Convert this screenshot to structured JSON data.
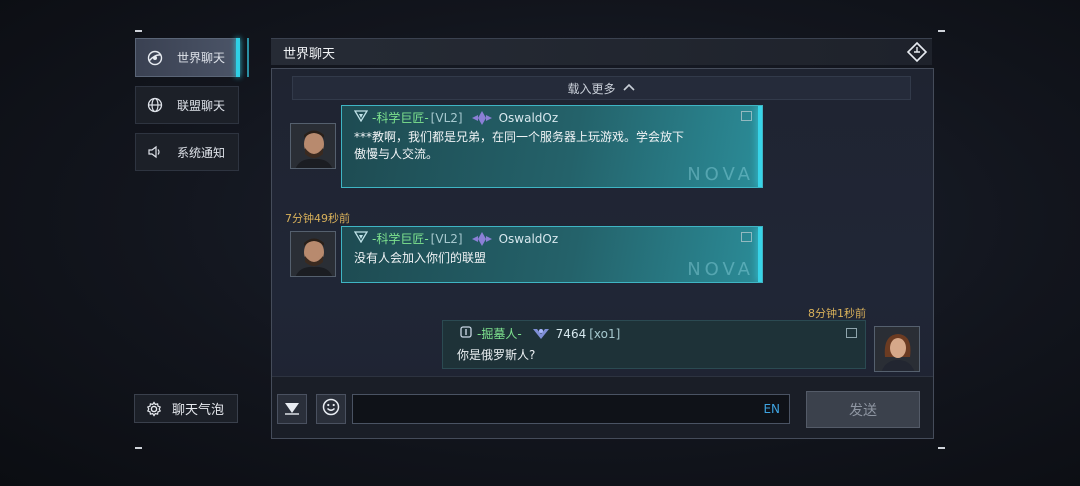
{
  "sidebar": {
    "items": [
      {
        "label": "世界聊天",
        "icon": "world-chat-icon",
        "active": true
      },
      {
        "label": "联盟聊天",
        "icon": "globe-icon",
        "active": false
      },
      {
        "label": "系统通知",
        "icon": "speaker-icon",
        "active": false
      }
    ],
    "bubble_label": "聊天气泡"
  },
  "header": {
    "title": "世界聊天",
    "icon": "diamond-icon"
  },
  "chat": {
    "load_more": "载入更多",
    "messages": [
      {
        "guild": "-科学巨匠-",
        "level": "[VL2]",
        "user": "OswaldOz",
        "lines": [
          "***教啊，我们都是兄弟，在同一个服务器上玩游戏。学会放下",
          "傲慢与人交流。"
        ],
        "watermark": "NOVA"
      },
      {
        "time": "7分钟49秒前",
        "guild": "-科学巨匠-",
        "level": "[VL2]",
        "user": "OswaldOz",
        "lines": [
          "没有人会加入你们的联盟"
        ],
        "watermark": "NOVA"
      },
      {
        "time": "8分钟1秒前",
        "guild": "-掘墓人-",
        "level": "[xo1]",
        "user": "7464",
        "lines": [
          "你是俄罗斯人?"
        ]
      }
    ]
  },
  "input": {
    "lang": "EN",
    "send_label": "发送"
  },
  "colors": {
    "accent": "#2fd0e6",
    "guild_green": "#7ee38f",
    "time_gold": "#d9b15a",
    "lang_blue": "#3ea3e0"
  }
}
